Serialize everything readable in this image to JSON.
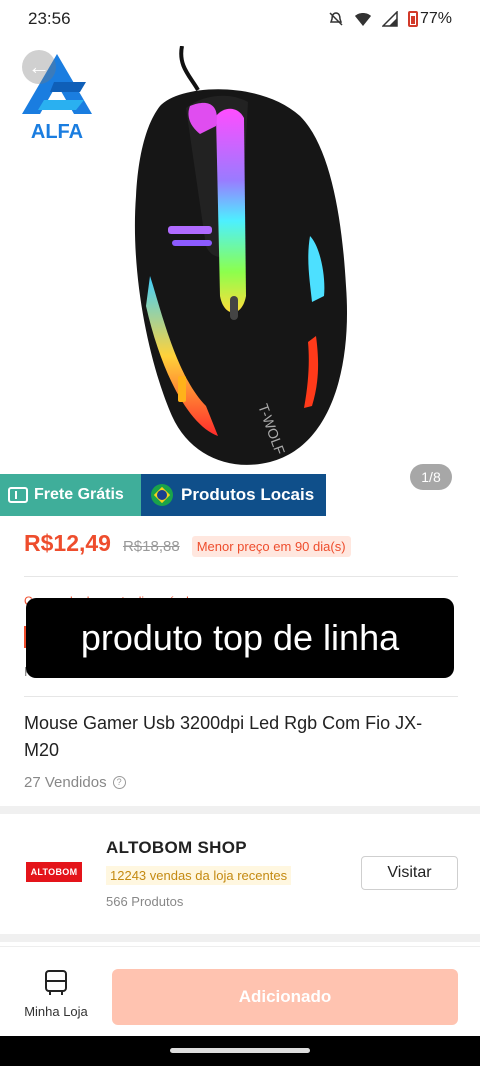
{
  "status_bar": {
    "time": "23:56",
    "battery_percent": "77%",
    "icons": [
      "mute-icon",
      "wifi-icon",
      "signal-icon",
      "battery-icon"
    ]
  },
  "hero": {
    "logo_text": "ALFA",
    "image_counter": "1/8",
    "mouse_brand": "T-WOLF"
  },
  "promo": {
    "free_shipping": "Frete Grátis",
    "local_products": "Produtos Locais"
  },
  "price": {
    "current": "R$12,49",
    "original": "R$18,88",
    "badge": "Menor preço em 90 dia(s)"
  },
  "partial": {
    "row_hint": "Cupom de desconto disponível",
    "initial": "F"
  },
  "caption": "produto top de linha",
  "product": {
    "title": "Mouse Gamer Usb 3200dpi Led Rgb Com Fio JX-M20",
    "sold": "27 Vendidos"
  },
  "shop": {
    "logo_text": "ALTOBOM",
    "name": "ALTOBOM SHOP",
    "sales": "12243 vendas da loja recentes",
    "products": "566 Produtos",
    "visit_label": "Visitar"
  },
  "bottom_bar": {
    "store_label": "Minha Loja",
    "add_label": "Adicionado"
  },
  "colors": {
    "accent": "#ee4d2d",
    "free_shipping_bg": "#3fae9a",
    "local_products_bg": "#0f4f8a",
    "add_button_bg": "#ffc3b0"
  }
}
